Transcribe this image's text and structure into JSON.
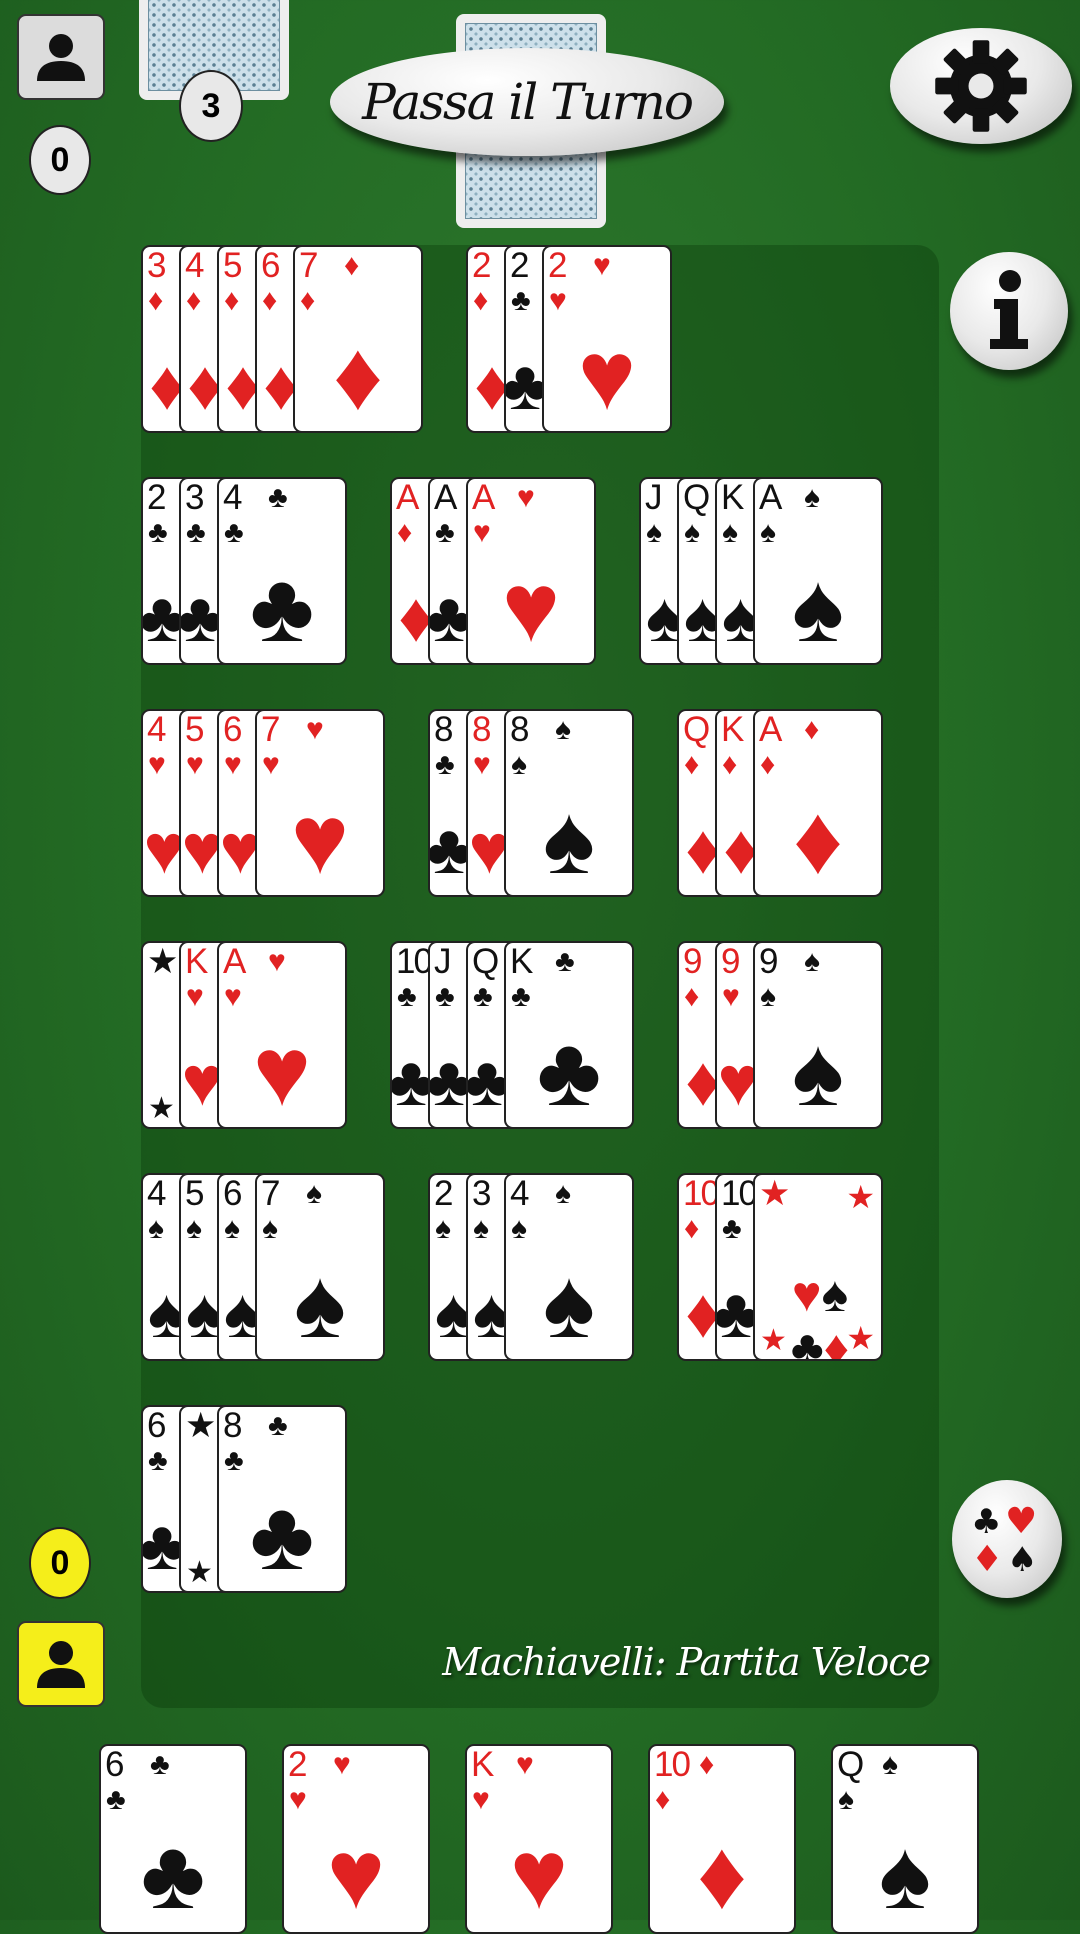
{
  "colors": {
    "felt": "#236b24",
    "red_suit": "#e12222",
    "black_suit": "#111111",
    "player_yellow": "#f5ee1a"
  },
  "opponent": {
    "score": "0",
    "card_count": "3",
    "avatar_icon": "person-icon"
  },
  "player": {
    "score": "0",
    "avatar_icon": "person-icon"
  },
  "pass_button": {
    "label": "Passa il Turno"
  },
  "buttons": {
    "settings_icon": "gear-icon",
    "info_icon": "info-icon",
    "suits_icon": "card-suits-icon"
  },
  "game_title": "Machiavelli:  Partita Veloce",
  "table_melds": [
    {
      "cards": [
        {
          "r": "3",
          "s": "♦",
          "c": "red"
        },
        {
          "r": "4",
          "s": "♦",
          "c": "red"
        },
        {
          "r": "5",
          "s": "♦",
          "c": "red"
        },
        {
          "r": "6",
          "s": "♦",
          "c": "red"
        },
        {
          "r": "7",
          "s": "♦",
          "c": "red"
        }
      ]
    },
    {
      "cards": [
        {
          "r": "2",
          "s": "♦",
          "c": "red"
        },
        {
          "r": "2",
          "s": "♣",
          "c": "blk"
        },
        {
          "r": "2",
          "s": "♥",
          "c": "red"
        }
      ]
    },
    {
      "cards": [
        {
          "r": "2",
          "s": "♣",
          "c": "blk"
        },
        {
          "r": "3",
          "s": "♣",
          "c": "blk"
        },
        {
          "r": "4",
          "s": "♣",
          "c": "blk"
        }
      ]
    },
    {
      "cards": [
        {
          "r": "A",
          "s": "♦",
          "c": "red"
        },
        {
          "r": "A",
          "s": "♣",
          "c": "blk"
        },
        {
          "r": "A",
          "s": "♥",
          "c": "red"
        }
      ]
    },
    {
      "cards": [
        {
          "r": "J",
          "s": "♠",
          "c": "blk"
        },
        {
          "r": "Q",
          "s": "♠",
          "c": "blk"
        },
        {
          "r": "K",
          "s": "♠",
          "c": "blk"
        },
        {
          "r": "A",
          "s": "♠",
          "c": "blk"
        }
      ]
    },
    {
      "cards": [
        {
          "r": "4",
          "s": "♥",
          "c": "red"
        },
        {
          "r": "5",
          "s": "♥",
          "c": "red"
        },
        {
          "r": "6",
          "s": "♥",
          "c": "red"
        },
        {
          "r": "7",
          "s": "♥",
          "c": "red"
        }
      ]
    },
    {
      "cards": [
        {
          "r": "8",
          "s": "♣",
          "c": "blk"
        },
        {
          "r": "8",
          "s": "♥",
          "c": "red"
        },
        {
          "r": "8",
          "s": "♠",
          "c": "blk"
        }
      ]
    },
    {
      "cards": [
        {
          "r": "Q",
          "s": "♦",
          "c": "red"
        },
        {
          "r": "K",
          "s": "♦",
          "c": "red"
        },
        {
          "r": "A",
          "s": "♦",
          "c": "red"
        }
      ]
    },
    {
      "cards": [
        {
          "r": "★",
          "s": "",
          "c": "blk",
          "joker": true
        },
        {
          "r": "K",
          "s": "♥",
          "c": "red"
        },
        {
          "r": "A",
          "s": "♥",
          "c": "red"
        }
      ]
    },
    {
      "cards": [
        {
          "r": "10",
          "s": "♣",
          "c": "blk"
        },
        {
          "r": "J",
          "s": "♣",
          "c": "blk"
        },
        {
          "r": "Q",
          "s": "♣",
          "c": "blk"
        },
        {
          "r": "K",
          "s": "♣",
          "c": "blk"
        }
      ]
    },
    {
      "cards": [
        {
          "r": "9",
          "s": "♦",
          "c": "red"
        },
        {
          "r": "9",
          "s": "♥",
          "c": "red"
        },
        {
          "r": "9",
          "s": "♠",
          "c": "blk"
        }
      ]
    },
    {
      "cards": [
        {
          "r": "4",
          "s": "♠",
          "c": "blk"
        },
        {
          "r": "5",
          "s": "♠",
          "c": "blk"
        },
        {
          "r": "6",
          "s": "♠",
          "c": "blk"
        },
        {
          "r": "7",
          "s": "♠",
          "c": "blk"
        }
      ]
    },
    {
      "cards": [
        {
          "r": "2",
          "s": "♠",
          "c": "blk"
        },
        {
          "r": "3",
          "s": "♠",
          "c": "blk"
        },
        {
          "r": "4",
          "s": "♠",
          "c": "blk"
        }
      ]
    },
    {
      "cards": [
        {
          "r": "10",
          "s": "♦",
          "c": "red"
        },
        {
          "r": "10",
          "s": "♣",
          "c": "blk"
        },
        {
          "r": "★",
          "s": "",
          "c": "red",
          "joker": true
        }
      ]
    },
    {
      "cards": [
        {
          "r": "6",
          "s": "♣",
          "c": "blk"
        },
        {
          "r": "★",
          "s": "",
          "c": "blk",
          "joker": true
        },
        {
          "r": "8",
          "s": "♣",
          "c": "blk"
        }
      ]
    }
  ],
  "hand": [
    {
      "r": "6",
      "s": "♣",
      "c": "blk"
    },
    {
      "r": "2",
      "s": "♥",
      "c": "red"
    },
    {
      "r": "K",
      "s": "♥",
      "c": "red"
    },
    {
      "r": "10",
      "s": "♦",
      "c": "red"
    },
    {
      "r": "Q",
      "s": "♠",
      "c": "blk"
    }
  ]
}
